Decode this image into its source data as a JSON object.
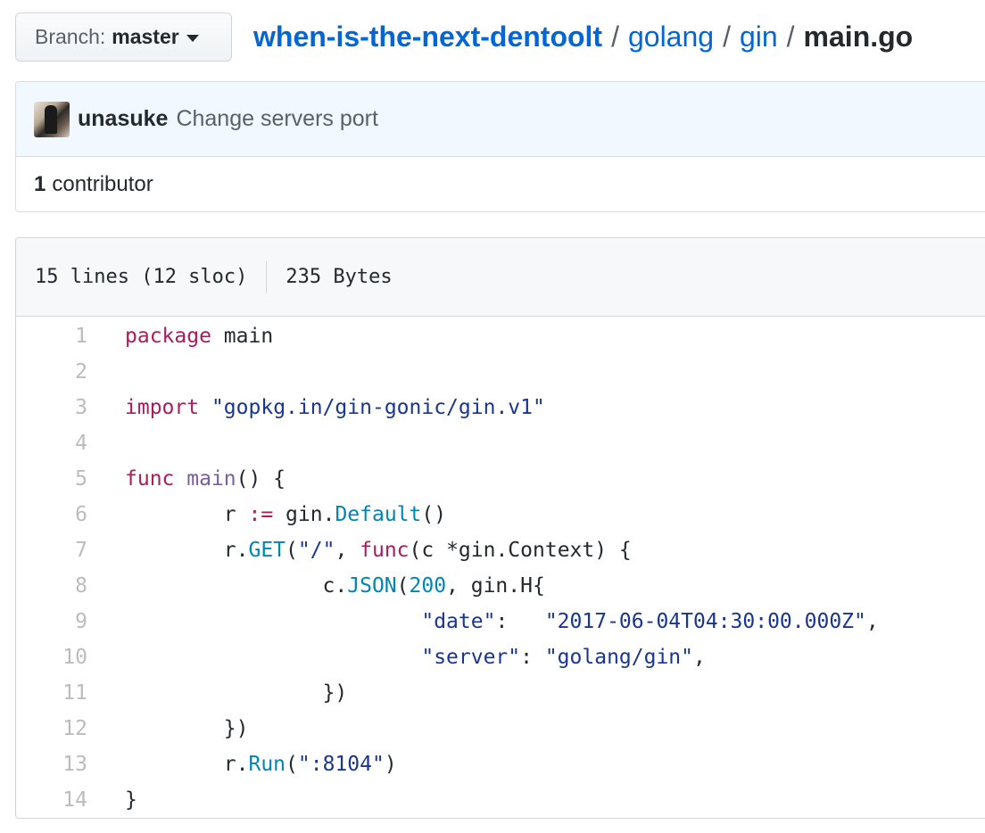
{
  "branch": {
    "label": "Branch:",
    "value": "master"
  },
  "breadcrumb": {
    "repo": "when-is-the-next-dentoolt",
    "sep": "/",
    "parts": [
      "golang",
      "gin"
    ],
    "file": "main.go"
  },
  "commit": {
    "author": "unasuke",
    "message": "Change servers port",
    "contributors_count": "1",
    "contributors_label": "contributor"
  },
  "file": {
    "lines_info": "15 lines (12 sloc)",
    "size": "235 Bytes",
    "line_numbers": [
      "1",
      "2",
      "3",
      "4",
      "5",
      "6",
      "7",
      "8",
      "9",
      "10",
      "11",
      "12",
      "13",
      "14"
    ]
  },
  "code": {
    "l1": {
      "kw": "package",
      "rest": " main"
    },
    "l3": {
      "kw": "import",
      "str": "\"gopkg.in/gin-gonic/gin.v1\""
    },
    "l5": {
      "kw": "func",
      "fn": "main",
      "rest": "() {"
    },
    "l6": {
      "pre": "        r ",
      "op": ":=",
      "mid": " gin.",
      "mth": "Default",
      "rest": "()"
    },
    "l7": {
      "pre": "        r.",
      "mth": "GET",
      "p1": "(",
      "str": "\"/\"",
      "p2": ", ",
      "kw": "func",
      "rest": "(c *gin.Context) {"
    },
    "l8": {
      "pre": "                c.",
      "mth": "JSON",
      "p1": "(",
      "num": "200",
      "rest": ", gin.H{"
    },
    "l9": {
      "pre": "                        ",
      "key": "\"date\"",
      "colon": ":   ",
      "val": "\"2017-06-04T04:30:00.000Z\"",
      "rest": ","
    },
    "l10": {
      "pre": "                        ",
      "key": "\"server\"",
      "colon": ": ",
      "val": "\"golang/gin\"",
      "rest": ","
    },
    "l11": {
      "pre": "                })"
    },
    "l12": {
      "pre": "        })"
    },
    "l13": {
      "pre": "        r.",
      "mth": "Run",
      "p1": "(",
      "str": "\":8104\"",
      "rest": ")"
    },
    "l14": {
      "pre": "}"
    }
  },
  "colors": {
    "link": "#0366d6",
    "keyword": "#a71d5d",
    "function": "#795da3",
    "string": "#183691",
    "method": "#0086b3",
    "commit_bg": "#f1f8ff"
  }
}
